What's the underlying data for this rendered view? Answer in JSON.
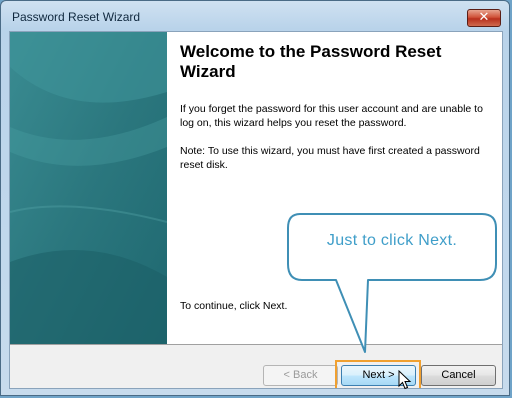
{
  "window": {
    "title": "Password Reset Wizard",
    "close_glyph": "✕"
  },
  "content": {
    "heading": "Welcome to the Password Reset Wizard",
    "paragraph1": "If you forget the password for this user account and are unable to log on, this wizard helps you reset the password.",
    "paragraph2": "Note: To use this wizard, you must have first created a password reset disk.",
    "continue_text": "To continue, click Next."
  },
  "buttons": {
    "back": "< Back",
    "next": "Next >",
    "cancel": "Cancel"
  },
  "annotation": {
    "callout_text": "Just to click Next.",
    "highlight_color": "#f0a030",
    "callout_stroke": "#3f8fb5"
  },
  "colors": {
    "panel_teal": "#2e7d85",
    "title_bar": "#c4dbef",
    "close_red": "#c8452d"
  }
}
